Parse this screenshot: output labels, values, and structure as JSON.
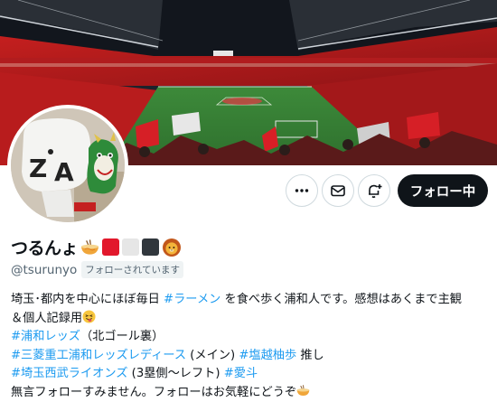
{
  "profile": {
    "display_name": "つるんょ",
    "handle": "@tsurunyo",
    "follows_you_badge": "フォローされています",
    "name_emojis": [
      "ramen-emoji",
      "red-square-emoji",
      "white-square-emoji",
      "black-square-emoji",
      "lion-emoji"
    ]
  },
  "actions": {
    "more_icon": "more-dots-icon",
    "message_icon": "mail-icon",
    "notify_icon": "bell-plus-icon",
    "follow_label": "フォロー中"
  },
  "bio": {
    "line1_text": "埼玉･都内を中心にほぼ毎日 ",
    "line1_tag": "#ラーメン",
    "line1_rest": " を食べ歩く浦和人です。感想はあくまで主観",
    "line2_text": "＆個人記録用",
    "line3_tag": "#浦和レッズ",
    "line3_rest": "（北ゴール裏）",
    "line4_tag1": "#三菱重工浦和レッズレディース",
    "line4_mid": " (メイン) ",
    "line4_tag2": "#塩越柚歩",
    "line4_rest": " 推し",
    "line5_tag1": "#埼玉西武ライオンズ",
    "line5_mid": " (3塁側～レフト)  ",
    "line5_tag2": "#愛斗",
    "line6_text": "無言フォローすみません。フォローはお気軽にどうぞ"
  },
  "colors": {
    "accent": "#1d9bf0",
    "text": "#0f1419",
    "muted": "#536471",
    "follow_bg": "#0f1419",
    "reds": "#e2182c"
  },
  "images": {
    "banner": "stadium-crowd-banner-image",
    "avatar": "mascot-figure-avatar-image"
  }
}
